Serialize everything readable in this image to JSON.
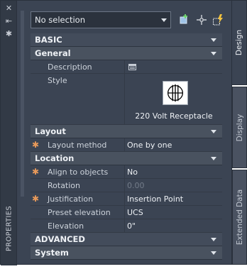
{
  "strip": {
    "title": "PROPERTIES",
    "icons": [
      "close-icon",
      "auto-hide-icon",
      "settings-icon"
    ]
  },
  "toolbar": {
    "selection_value": "No selection",
    "buttons": [
      "select-objects-icon",
      "pickadd-icon",
      "quick-select-icon"
    ]
  },
  "grid": {
    "basic": {
      "label": "BASIC",
      "general": {
        "label": "General",
        "description_label": "Description",
        "style_label": "Style",
        "style_value": "220 Volt Receptacle"
      },
      "layout": {
        "label": "Layout",
        "method_label": "Layout method",
        "method_value": "One by one"
      },
      "location": {
        "label": "Location",
        "align_label": "Align to objects",
        "align_value": "No",
        "rotation_label": "Rotation",
        "rotation_value": "0.00",
        "justification_label": "Justification",
        "justification_value": "Insertion Point",
        "preset_label": "Preset elevation",
        "preset_value": "UCS",
        "elevation_label": "Elevation",
        "elevation_value": "0\""
      }
    },
    "advanced": {
      "label": "ADVANCED"
    },
    "system": {
      "label": "System"
    }
  },
  "tabs": {
    "design": "Design",
    "display": "Display",
    "extended": "Extended Data"
  },
  "colors": {
    "panel": "#3b4453",
    "category": "#434c5b",
    "accent": "#e99a5a"
  }
}
